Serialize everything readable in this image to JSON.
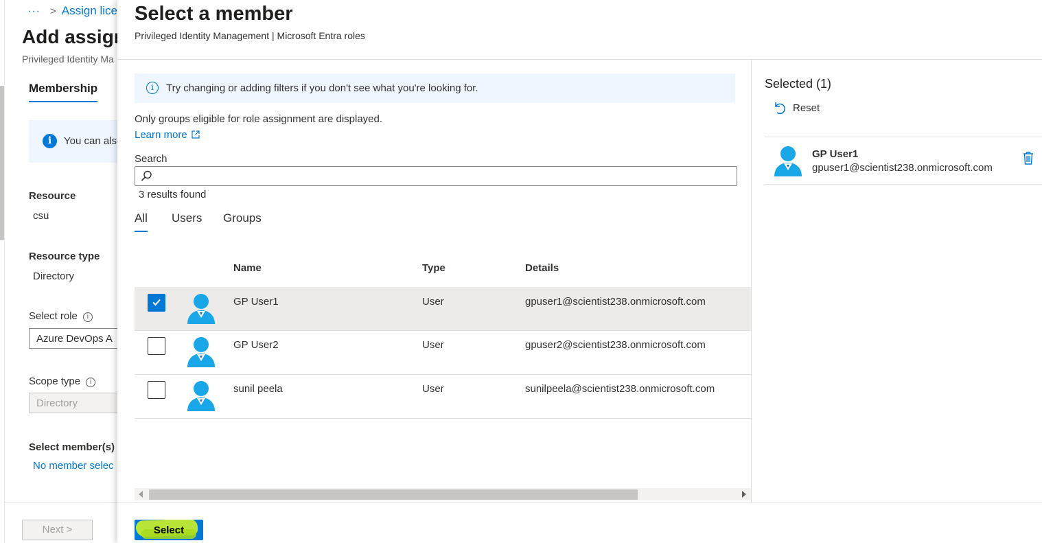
{
  "background_page": {
    "breadcrumb": {
      "ellipsis": "···",
      "item": "Assign lice"
    },
    "title": "Add assign",
    "subtitle": "Privileged Identity Ma",
    "tab": "Membership",
    "info_text": "You can also",
    "resource_label": "Resource",
    "resource_value": "csu",
    "resource_type_label": "Resource type",
    "resource_type_value": "Directory",
    "select_role_label": "Select role",
    "select_role_value": "Azure DevOps A",
    "scope_type_label": "Scope type",
    "scope_type_value": "Directory",
    "select_members_label": "Select member(s)",
    "no_member_text": "No member selec",
    "next_button": "Next >"
  },
  "panel": {
    "title": "Select a member",
    "subtitle": "Privileged Identity Management | Microsoft Entra roles",
    "info_banner": "Try changing or adding filters if you don't see what you're looking for.",
    "eligible_text": "Only groups eligible for role assignment are displayed.",
    "learn_more": "Learn more",
    "search_label": "Search",
    "search_value": "",
    "results_count": "3 results found",
    "tabs": [
      {
        "label": "All",
        "active": true
      },
      {
        "label": "Users",
        "active": false
      },
      {
        "label": "Groups",
        "active": false
      }
    ],
    "table": {
      "headers": {
        "name": "Name",
        "type": "Type",
        "details": "Details"
      },
      "rows": [
        {
          "name": "GP User1",
          "type": "User",
          "details": "gpuser1@scientist238.onmicrosoft.com",
          "checked": true
        },
        {
          "name": "GP User2",
          "type": "User",
          "details": "gpuser2@scientist238.onmicrosoft.com",
          "checked": false
        },
        {
          "name": "sunil peela",
          "type": "User",
          "details": "sunilpeela@scientist238.onmicrosoft.com",
          "checked": false
        }
      ]
    },
    "select_button": "Select",
    "selected_pane": {
      "title": "Selected (1)",
      "reset": "Reset",
      "items": [
        {
          "name": "GP User1",
          "email": "gpuser1@scientist238.onmicrosoft.com"
        }
      ]
    }
  },
  "colors": {
    "accent": "#0078d4",
    "highlight": "#c8ef2a",
    "avatar": "#1aa7e8"
  }
}
